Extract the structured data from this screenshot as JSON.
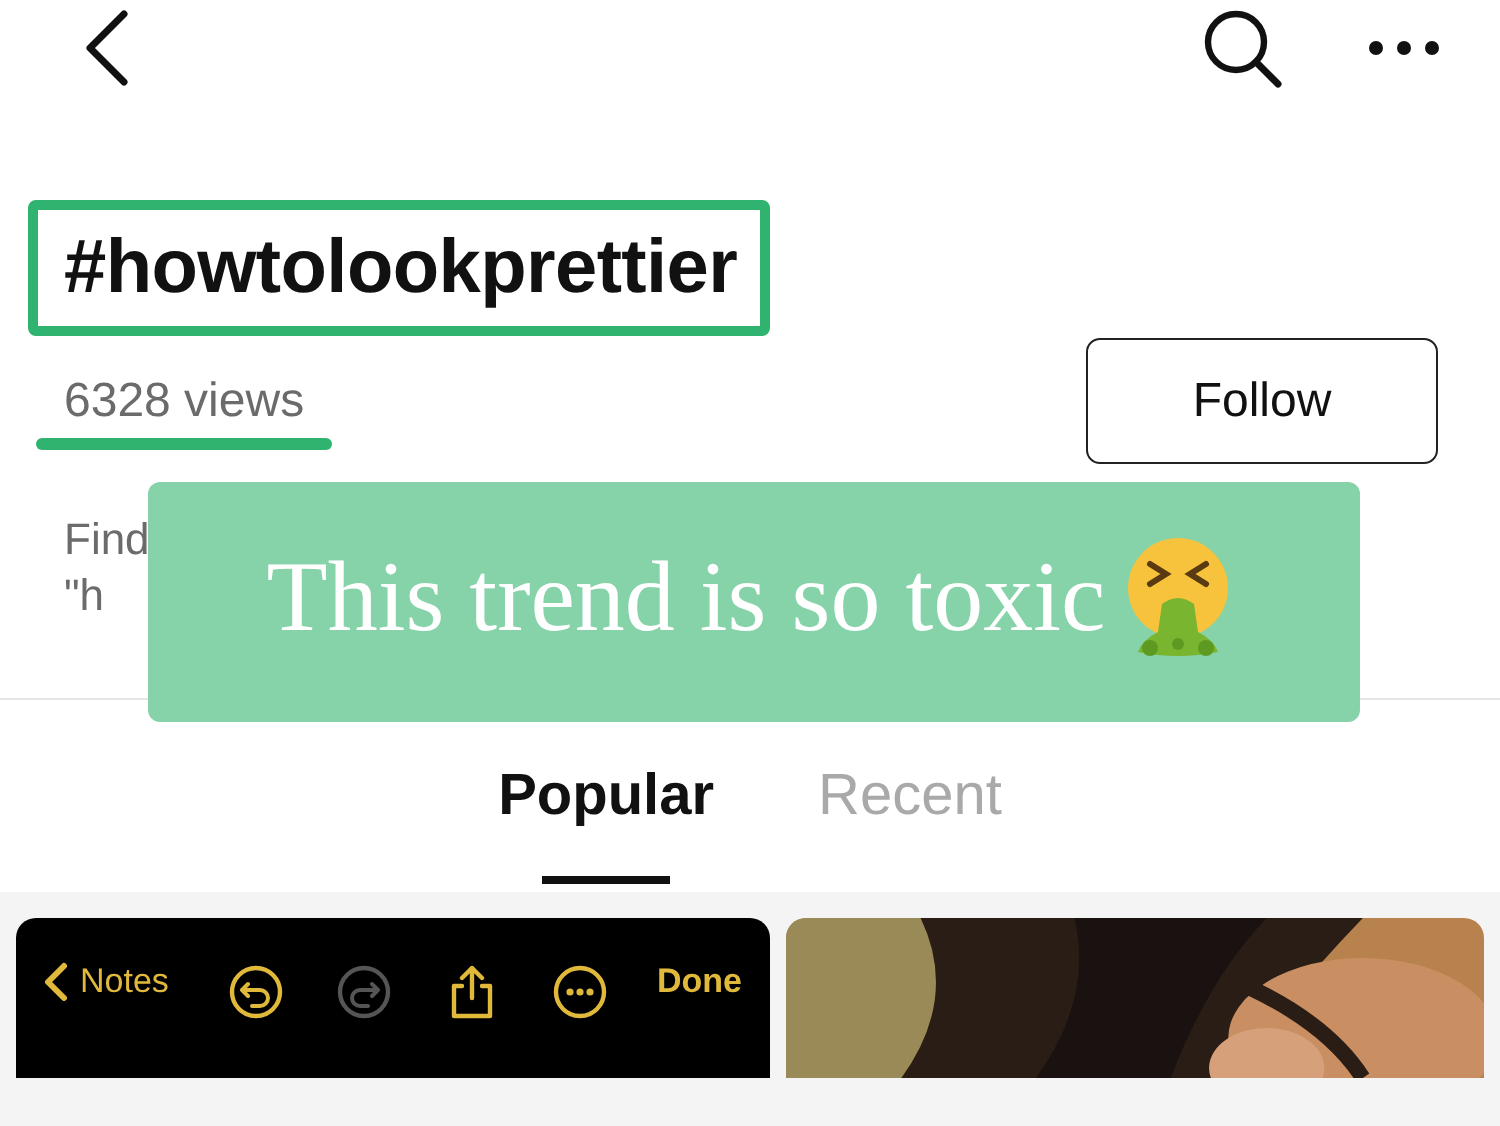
{
  "header": {
    "title": "#howtolookprettier",
    "views": "6328 views",
    "follow_button": "Follow",
    "description_lines": [
      "Find",
      "\"h"
    ]
  },
  "caption_overlay": {
    "text": "This trend is so toxic"
  },
  "tabs": [
    {
      "label": "Popular",
      "selected": true
    },
    {
      "label": "Recent",
      "selected": false
    }
  ],
  "posts": [
    {
      "kind": "notes_screenshot",
      "back_label": "Notes",
      "done_label": "Done",
      "tools": [
        {
          "kind": "undo",
          "disabled": false
        },
        {
          "kind": "redo",
          "disabled": true
        },
        {
          "kind": "share",
          "disabled": false
        },
        {
          "kind": "more",
          "disabled": false
        }
      ]
    },
    {
      "kind": "picture"
    }
  ]
}
